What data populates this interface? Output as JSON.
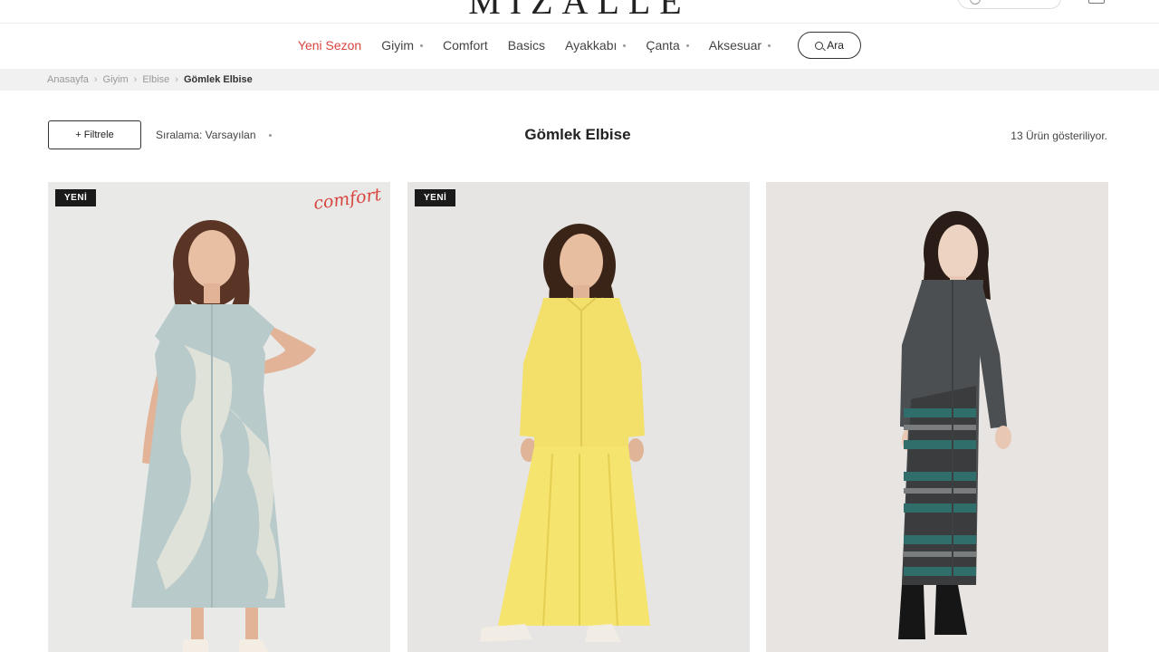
{
  "header": {
    "logo": "MIZALLE",
    "top_left_text": "",
    "top_search_placeholder": ""
  },
  "nav": {
    "items": [
      {
        "label": "Yeni Sezon",
        "active": true,
        "has_dropdown": false
      },
      {
        "label": "Giyim",
        "active": false,
        "has_dropdown": true
      },
      {
        "label": "Comfort",
        "active": false,
        "has_dropdown": false
      },
      {
        "label": "Basics",
        "active": false,
        "has_dropdown": false
      },
      {
        "label": "Ayakkabı",
        "active": false,
        "has_dropdown": true
      },
      {
        "label": "Çanta",
        "active": false,
        "has_dropdown": true
      },
      {
        "label": "Aksesuar",
        "active": false,
        "has_dropdown": true
      }
    ],
    "search_label": "Ara"
  },
  "breadcrumb": {
    "items": [
      "Anasayfa",
      "Giyim",
      "Elbise"
    ],
    "current": "Gömlek Elbise",
    "separator": "›"
  },
  "toolbar": {
    "filter_label": "+ Filtrele",
    "sort_label": "Sıralama: Varsayılan",
    "title": "Gömlek Elbise",
    "result_count": "13 Ürün gösteriliyor."
  },
  "products": [
    {
      "badge": "YENİ",
      "tag": "comfort",
      "dress_color": "#b9cacb",
      "bg": "#e9e9e8"
    },
    {
      "badge": "YENİ",
      "tag": "",
      "dress_color": "#f3e06a",
      "bg": "#e6e5e3"
    },
    {
      "badge": "",
      "tag": "",
      "dress_color": "#4b4f52",
      "bg": "#e7e4e1"
    }
  ],
  "colors": {
    "accent": "#d8453f",
    "badge_bg": "#1a1a1a",
    "breadcrumb_bg": "#f1f1f1"
  }
}
